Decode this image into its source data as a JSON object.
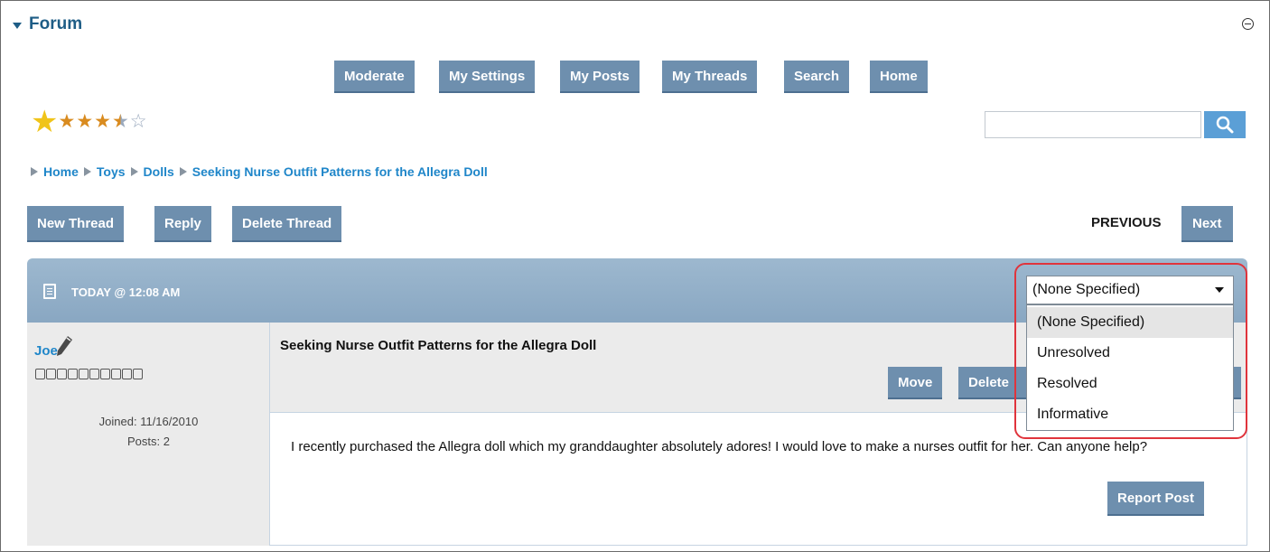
{
  "header": {
    "title": "Forum"
  },
  "nav": {
    "buttons": [
      "Moderate",
      "My Settings",
      "My Posts",
      "My Threads",
      "Search",
      "Home"
    ]
  },
  "rating": {
    "stars_filled": 3.5,
    "stars_total": 5
  },
  "breadcrumb": [
    "Home",
    "Toys",
    "Dolls",
    "Seeking Nurse Outfit Patterns for the Allegra Doll"
  ],
  "thread_actions": {
    "new_thread": "New Thread",
    "reply": "Reply",
    "delete_thread": "Delete Thread"
  },
  "pager": {
    "previous": "PREVIOUS",
    "next": "Next"
  },
  "post": {
    "date": "TODAY @ 12:08 AM",
    "author": "Joe",
    "rank_boxes": "□□□□□□□□□□",
    "joined": "Joined: 11/16/2010",
    "posts": "Posts: 2",
    "subject": "Seeking Nurse Outfit Patterns for the Allegra Doll",
    "move": "Move",
    "delete": "Delete",
    "body": "I recently purchased the Allegra doll which my granddaughter absolutely adores! I would love to make a nurses outfit for her. Can anyone help?",
    "report": "Report Post"
  },
  "status_select": {
    "selected": "(None Specified)",
    "options": [
      "(None Specified)",
      "Unresolved",
      "Resolved",
      "Informative"
    ]
  },
  "colors": {
    "button_bg": "#6e8fae",
    "link": "#1f86c9",
    "title": "#1e5d86",
    "highlight": "#e0343c"
  }
}
